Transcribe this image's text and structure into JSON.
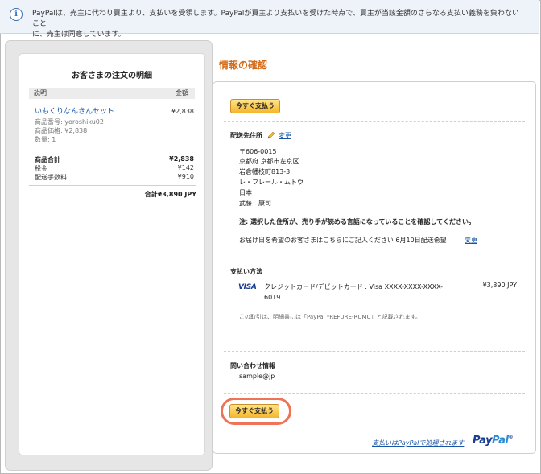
{
  "notice": {
    "line1": "PayPalは、売主に代わり買主より、支払いを受領します。PayPalが買主より支払いを受けた時点で、買主が当該金額のさらなる支払い義務を負わないこと",
    "line2": "に、売主は同意しています。",
    "icon": "info-icon"
  },
  "summary": {
    "title": "お客さまの注文の明細",
    "col_desc": "説明",
    "col_amount": "金額",
    "item": {
      "name": "いもくりなんきんセット",
      "price": "¥2,838",
      "sku": "商品番号: yoroshiku02",
      "unit_price": "商品価格: ¥2,838",
      "qty": "数量: 1"
    },
    "subtotal_label": "商品合計",
    "subtotal": "¥2,838",
    "tax_label": "税金",
    "tax": "¥142",
    "shipping_label": "配送手数料:",
    "shipping": "¥910",
    "grand_total": "合計¥3,890 JPY"
  },
  "confirm": {
    "title": "情報の確認",
    "pay_button": "今すぐ支払う",
    "shipping_title": "配送先住所",
    "change": "変更",
    "address": [
      "〒606-0015",
      "京都府 京都市左京区",
      "岩倉幡枝町813-3",
      "レ・フレール・ムトウ",
      "日本",
      "武藤　康司"
    ],
    "note": "注: 選択した住所が、売り手が読める言語になっていることを確認してください。",
    "delivery_note": "お届け日を希望のお客さまはこちらにご記入ください 6月10日配送希望",
    "payment_title": "支払い方法",
    "card_brand": "VISA",
    "card_line1": "クレジットカード/デビットカード : Visa XXXX-XXXX-XXXX-",
    "card_line2": "6019",
    "card_amount": "¥3,890 JPY",
    "statement_note": "この取引は、明細書には「PayPal *REFURE-RUMU」と記載されます。",
    "contact_title": "問い合わせ情報",
    "contact_email": "sample@jp"
  },
  "footer": {
    "processed": "支払いはPayPalで処理されます",
    "logo_pay": "Pay",
    "logo_pal": "Pal",
    "logo_tm": "®"
  }
}
